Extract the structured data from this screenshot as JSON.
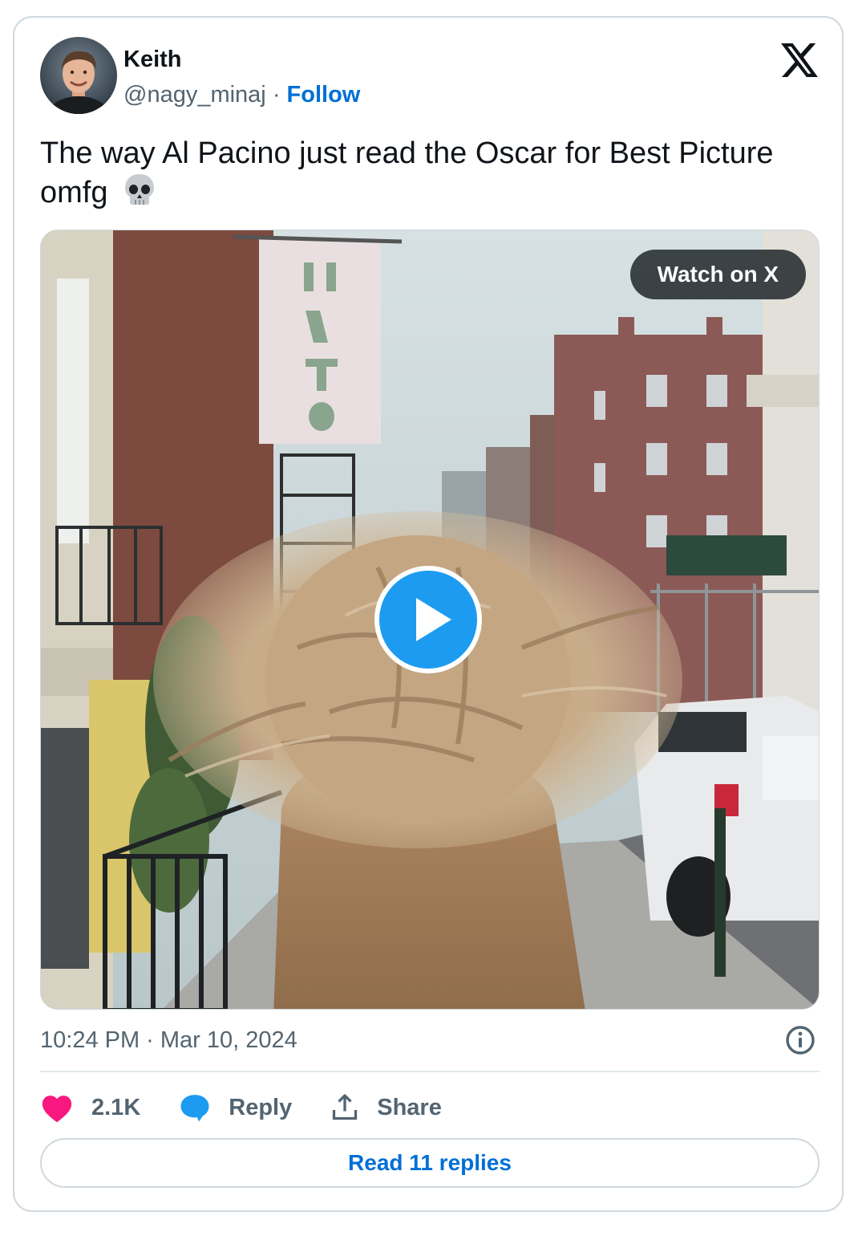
{
  "author": {
    "name": "Keith",
    "handle": "@nagy_minaj",
    "separator": " · ",
    "follow_label": "Follow"
  },
  "tweet": {
    "text": "The way Al Pacino just read the Oscar for Best Picture omfg",
    "emoji_icon": "skull-icon"
  },
  "media": {
    "watch_label": "Watch on X",
    "play_icon": "play-icon"
  },
  "timestamp": "10:24 PM · Mar 10, 2024",
  "actions": {
    "likes_count": "2.1K",
    "reply_label": "Reply",
    "share_label": "Share"
  },
  "read_replies_label": "Read 11 replies",
  "colors": {
    "link_blue": "#006fd6",
    "like_pink": "#f91880",
    "reply_blue": "#1d9bf0",
    "muted_text": "#536471",
    "border": "#cfd9de"
  }
}
